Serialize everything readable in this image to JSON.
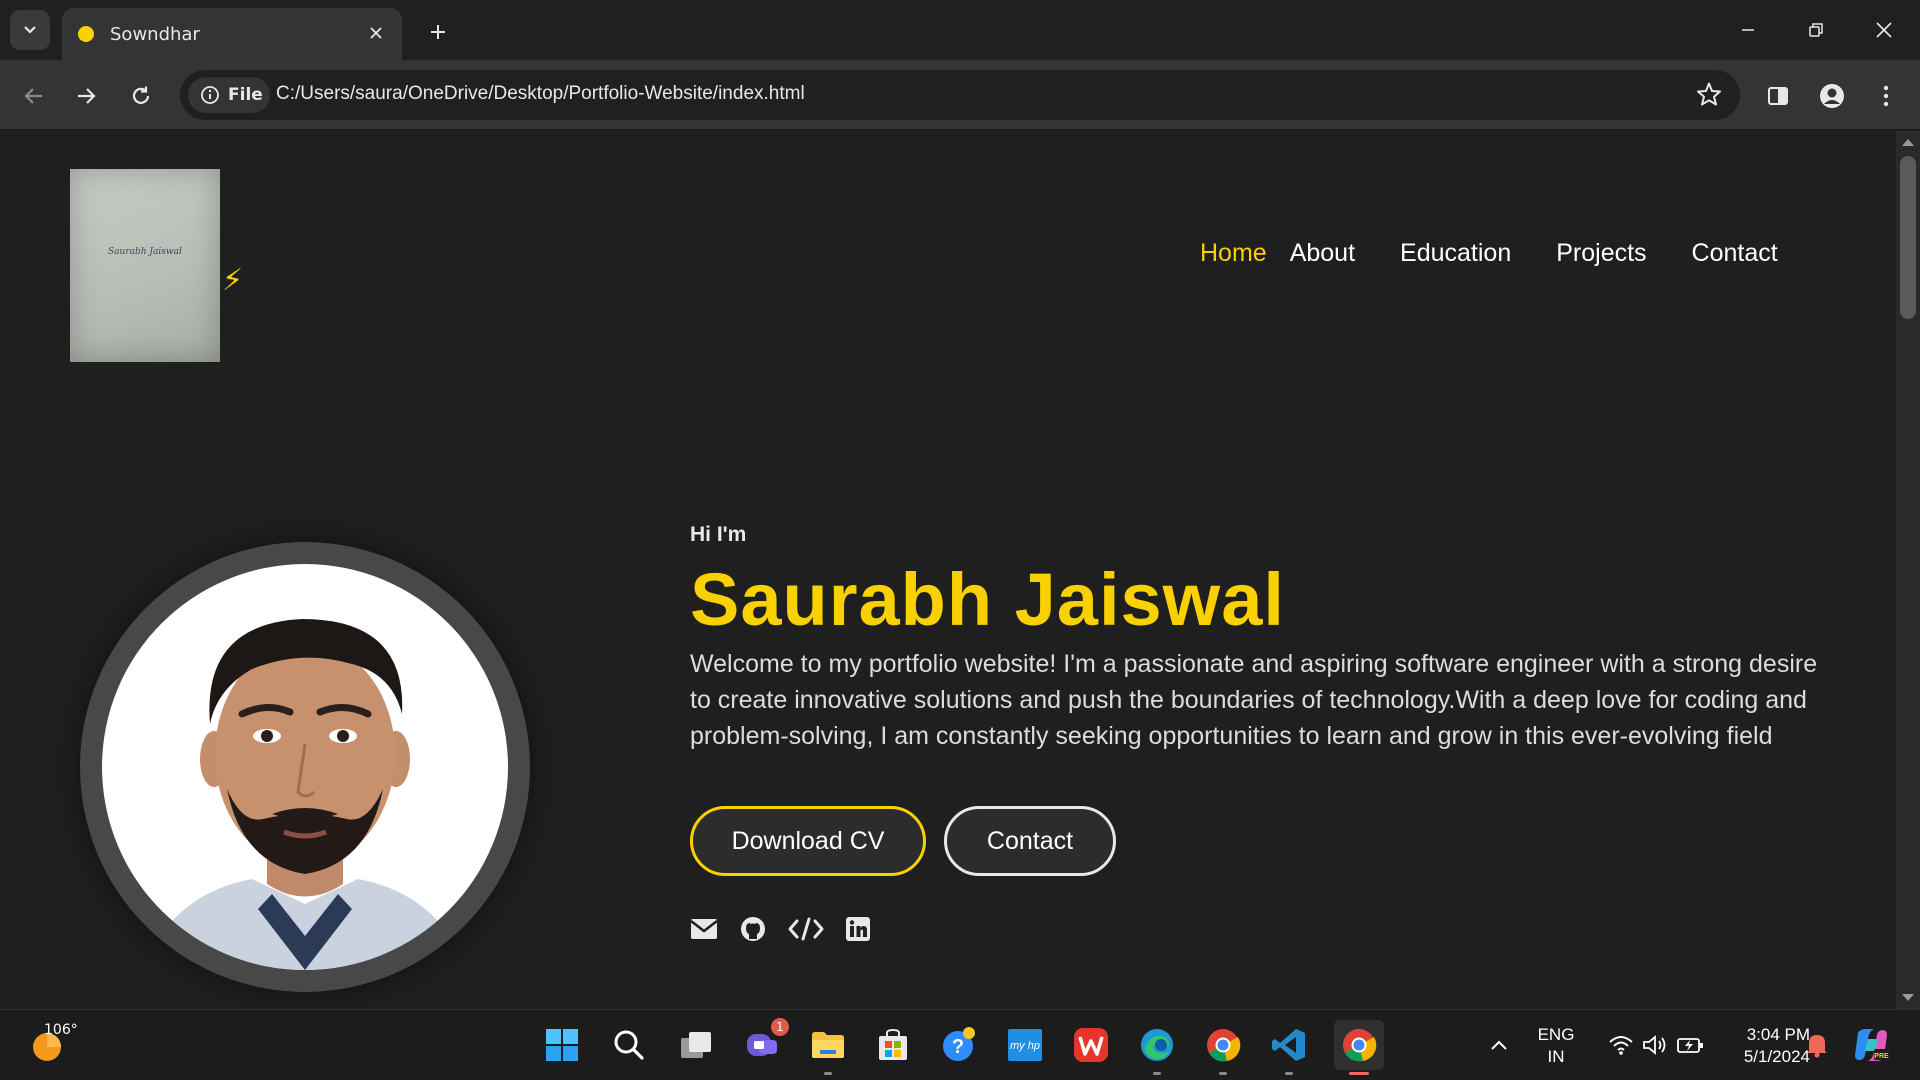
{
  "browser": {
    "tab_title": "Sowndhar",
    "url_chip": "File",
    "url": "C:/Users/saura/OneDrive/Desktop/Portfolio-Website/index.html"
  },
  "site": {
    "logo_signature": "Saurabh Jaiswal",
    "nav": [
      {
        "label": "Home",
        "active": true
      },
      {
        "label": "About"
      },
      {
        "label": "Education"
      },
      {
        "label": "Projects"
      },
      {
        "label": "Contact"
      }
    ],
    "hero": {
      "greeting": "Hi I'm",
      "name": "Saurabh Jaiswal",
      "description": "Welcome to my portfolio website! I'm a passionate and aspiring software engineer with a strong desire to create innovative solutions and push the boundaries of technology.With a deep love for coding and problem-solving, I am constantly seeking opportunities to learn and grow in this ever-evolving field",
      "download_cv": "Download CV",
      "contact": "Contact"
    },
    "socials": [
      "email-icon",
      "github-icon",
      "code-icon",
      "linkedin-icon"
    ],
    "accent_color": "#f9d000"
  },
  "taskbar": {
    "weather_temp": "106°",
    "chat_badge": "1",
    "lang_line1": "ENG",
    "lang_line2": "IN",
    "time": "3:04 PM",
    "date": "5/1/2024"
  }
}
